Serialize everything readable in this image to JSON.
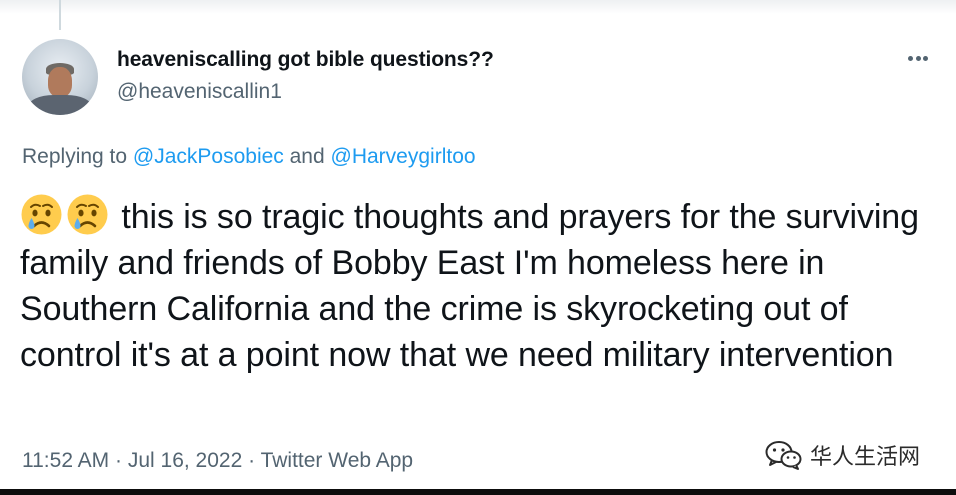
{
  "tweet": {
    "author": {
      "display_name": "heavenis­calling got bible questions??",
      "handle": "@heaveniscallin1",
      "avatar": "user-avatar-photo"
    },
    "more_icon": "ellipsis-icon",
    "replying": {
      "prefix": "Replying to ",
      "mention_1": "@JackPosobiec",
      "connector": " and ",
      "mention_2": "@Harveygirltoo"
    },
    "emoji": "crying-face-emoji",
    "text": "this is so tragic thoughts and prayers for the surviving family and friends of Bobby East I'm homeless here in Southern California and the crime is skyrocketing out of control it's at a point now that we need military intervention",
    "time": "11:52 AM",
    "separator": " · ",
    "date": "Jul 16, 2022",
    "source": "Twitter Web App"
  },
  "watermark": {
    "icon": "wechat-logo-icon",
    "text": "华人生活网"
  },
  "colors": {
    "text": "#0f1419",
    "secondary": "#536471",
    "link": "#1d9bf0",
    "background": "#ffffff"
  }
}
